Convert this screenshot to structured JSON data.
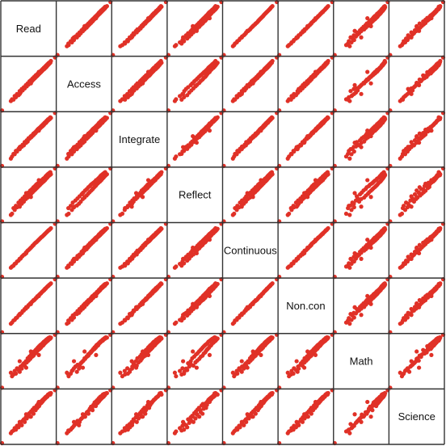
{
  "chart_data": {
    "type": "scatter",
    "subtype": "scatterplot-matrix",
    "title": "",
    "variables": [
      "Read",
      "Access",
      "Integrate",
      "Reflect",
      "Continuous",
      "Non.con",
      "Math",
      "Science"
    ],
    "diagonal": "variable-names",
    "grid": false,
    "axis_ticks": false,
    "point_color": "#e03127",
    "border_color": "#333333",
    "range": [
      380,
      560
    ],
    "observations": [
      [
        380,
        380,
        380,
        380,
        380,
        380,
        380,
        380
      ],
      [
        560,
        560,
        560,
        560,
        560,
        560,
        560,
        560
      ],
      [
        410,
        412,
        405,
        402,
        411,
        409,
        431,
        414
      ],
      [
        414,
        418,
        412,
        406,
        415,
        413,
        419,
        420
      ],
      [
        419,
        417,
        421,
        425,
        418,
        420,
        425,
        423
      ],
      [
        423,
        429,
        420,
        419,
        424,
        422,
        437,
        431
      ],
      [
        427,
        425,
        431,
        433,
        426,
        428,
        428,
        426
      ],
      [
        431,
        436,
        429,
        428,
        432,
        430,
        446,
        439
      ],
      [
        436,
        432,
        438,
        444,
        435,
        437,
        440,
        434
      ],
      [
        440,
        446,
        437,
        434,
        441,
        442,
        434,
        445
      ],
      [
        443,
        441,
        446,
        451,
        442,
        444,
        452,
        449
      ],
      [
        447,
        453,
        445,
        440,
        448,
        446,
        445,
        441
      ],
      [
        450,
        448,
        452,
        458,
        451,
        452,
        458,
        456
      ],
      [
        454,
        459,
        450,
        447,
        455,
        454,
        463,
        461
      ],
      [
        457,
        455,
        461,
        465,
        456,
        459,
        455,
        452
      ],
      [
        461,
        466,
        458,
        456,
        462,
        460,
        470,
        468
      ],
      [
        464,
        462,
        467,
        472,
        465,
        466,
        466,
        464
      ],
      [
        467,
        472,
        463,
        461,
        469,
        466,
        480,
        473
      ],
      [
        470,
        468,
        474,
        478,
        471,
        472,
        472,
        477
      ],
      [
        473,
        479,
        472,
        468,
        474,
        474,
        486,
        482
      ],
      [
        476,
        474,
        478,
        485,
        477,
        478,
        478,
        470
      ],
      [
        479,
        484,
        477,
        474,
        480,
        480,
        493,
        488
      ],
      [
        482,
        480,
        484,
        490,
        483,
        484,
        485,
        485
      ],
      [
        484,
        489,
        482,
        479,
        486,
        485,
        497,
        494
      ],
      [
        487,
        485,
        490,
        496,
        488,
        489,
        489,
        480
      ],
      [
        489,
        494,
        487,
        484,
        491,
        489,
        503,
        500
      ],
      [
        492,
        490,
        494,
        500,
        494,
        492,
        496,
        497
      ],
      [
        494,
        499,
        492,
        489,
        496,
        495,
        508,
        492
      ],
      [
        496,
        494,
        498,
        505,
        497,
        497,
        500,
        504
      ],
      [
        498,
        502,
        497,
        493,
        499,
        498,
        512,
        508
      ],
      [
        500,
        498,
        503,
        508,
        501,
        502,
        505,
        500
      ],
      [
        502,
        506,
        500,
        497,
        503,
        503,
        517,
        513
      ],
      [
        504,
        502,
        507,
        511,
        505,
        505,
        509,
        510
      ],
      [
        506,
        510,
        504,
        501,
        507,
        507,
        521,
        506
      ],
      [
        508,
        506,
        510,
        514,
        509,
        509,
        512,
        518
      ],
      [
        510,
        513,
        508,
        505,
        511,
        511,
        525,
        514
      ],
      [
        512,
        510,
        514,
        518,
        513,
        512,
        516,
        521
      ],
      [
        514,
        517,
        512,
        509,
        515,
        515,
        528,
        517
      ],
      [
        516,
        514,
        518,
        521,
        516,
        517,
        521,
        525
      ],
      [
        518,
        521,
        515,
        513,
        518,
        519,
        532,
        522
      ],
      [
        520,
        518,
        522,
        525,
        520,
        520,
        524,
        529
      ],
      [
        522,
        525,
        519,
        516,
        522,
        523,
        536,
        527
      ],
      [
        524,
        521,
        526,
        528,
        524,
        524,
        529,
        533
      ],
      [
        526,
        529,
        524,
        520,
        526,
        528,
        539,
        531
      ],
      [
        528,
        525,
        530,
        533,
        528,
        528,
        533,
        537
      ],
      [
        530,
        533,
        527,
        525,
        530,
        531,
        543,
        535
      ],
      [
        532,
        529,
        534,
        537,
        532,
        533,
        537,
        540
      ],
      [
        534,
        537,
        532,
        529,
        534,
        535,
        546,
        538
      ],
      [
        536,
        534,
        538,
        541,
        536,
        537,
        540,
        545
      ],
      [
        538,
        541,
        536,
        534,
        538,
        538,
        549,
        543
      ],
      [
        540,
        538,
        541,
        544,
        539,
        541,
        544,
        547
      ],
      [
        542,
        544,
        539,
        537,
        541,
        542,
        551,
        549
      ],
      [
        544,
        542,
        545,
        547,
        543,
        544,
        547,
        545
      ],
      [
        546,
        548,
        543,
        540,
        545,
        546,
        550,
        550
      ],
      [
        440,
        436,
        444,
        430,
        441,
        439,
        470,
        452
      ],
      [
        462,
        466,
        459,
        476,
        460,
        465,
        448,
        478
      ],
      [
        478,
        472,
        481,
        463,
        479,
        476,
        503,
        470
      ],
      [
        505,
        511,
        500,
        520,
        506,
        503,
        491,
        520
      ]
    ]
  }
}
